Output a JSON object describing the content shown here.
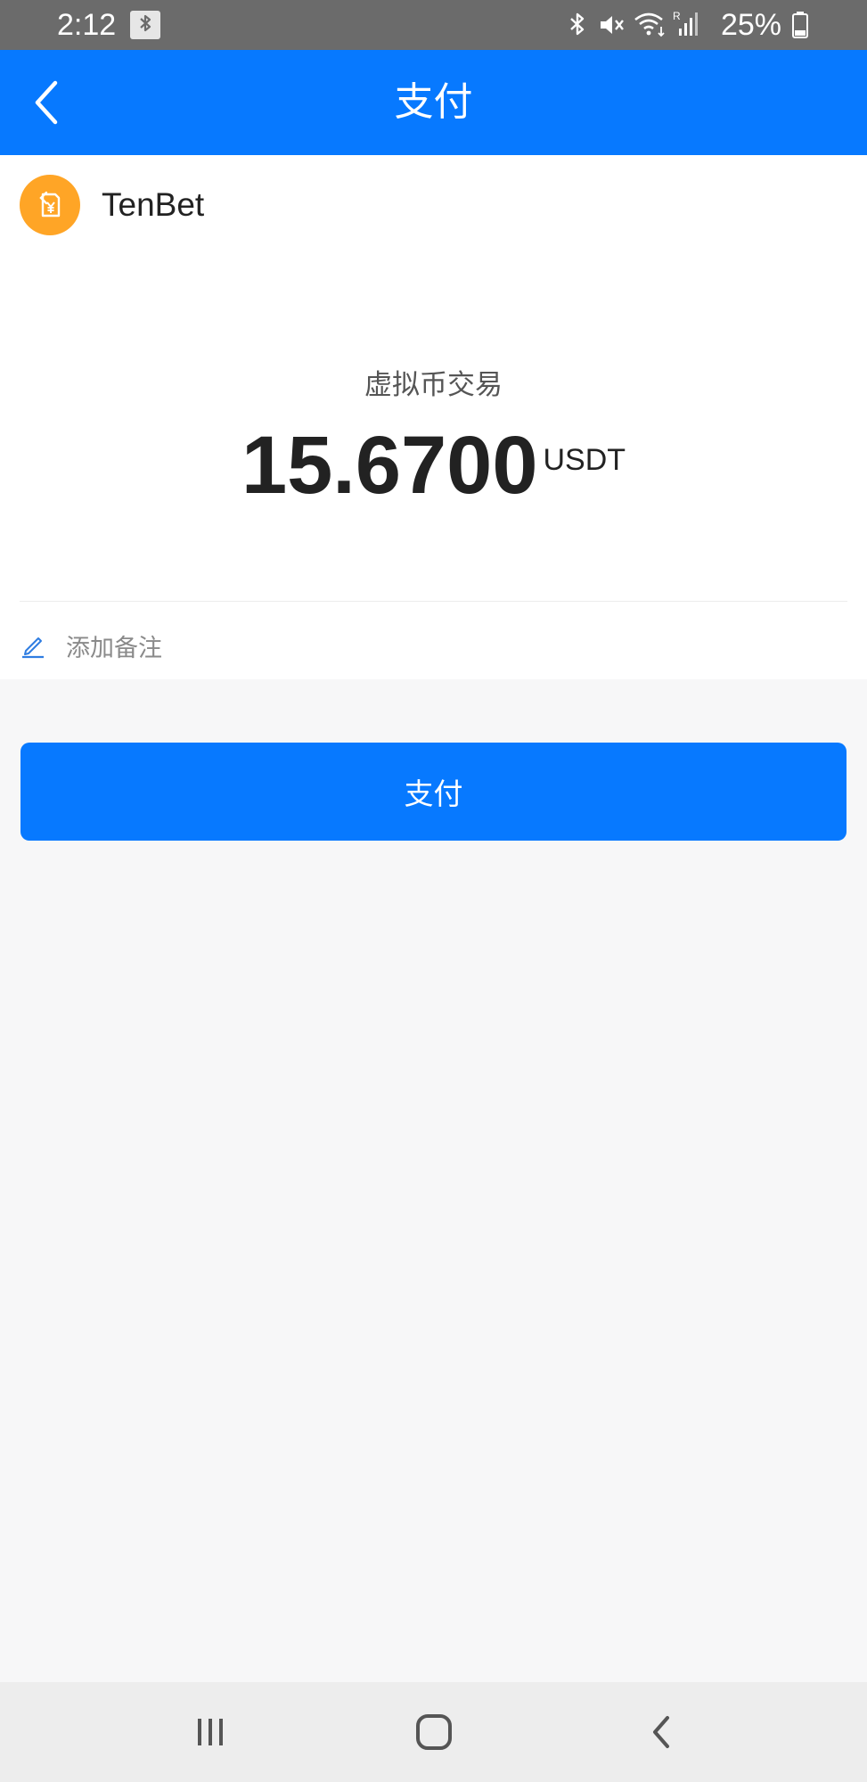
{
  "status_bar": {
    "time": "2:12",
    "battery_percent": "25%",
    "icons": [
      "bluetooth-icon",
      "mute-icon",
      "wifi-icon",
      "signal-icon",
      "battery-icon"
    ]
  },
  "header": {
    "title": "支付",
    "back_icon": "chevron-left-icon",
    "background_color": "#0779ff"
  },
  "merchant": {
    "name": "TenBet",
    "icon": "yuan-transfer-icon",
    "icon_color": "#ffa526"
  },
  "payment": {
    "type": "虚拟币交易",
    "amount": "15.6700",
    "unit": "USDT"
  },
  "note": {
    "icon": "edit-pencil-icon",
    "label": "添加备注"
  },
  "pay_button": {
    "label": "支付",
    "color": "#0779ff"
  },
  "nav_bar": {
    "icons": [
      "recent-apps-icon",
      "home-icon",
      "back-icon"
    ]
  }
}
